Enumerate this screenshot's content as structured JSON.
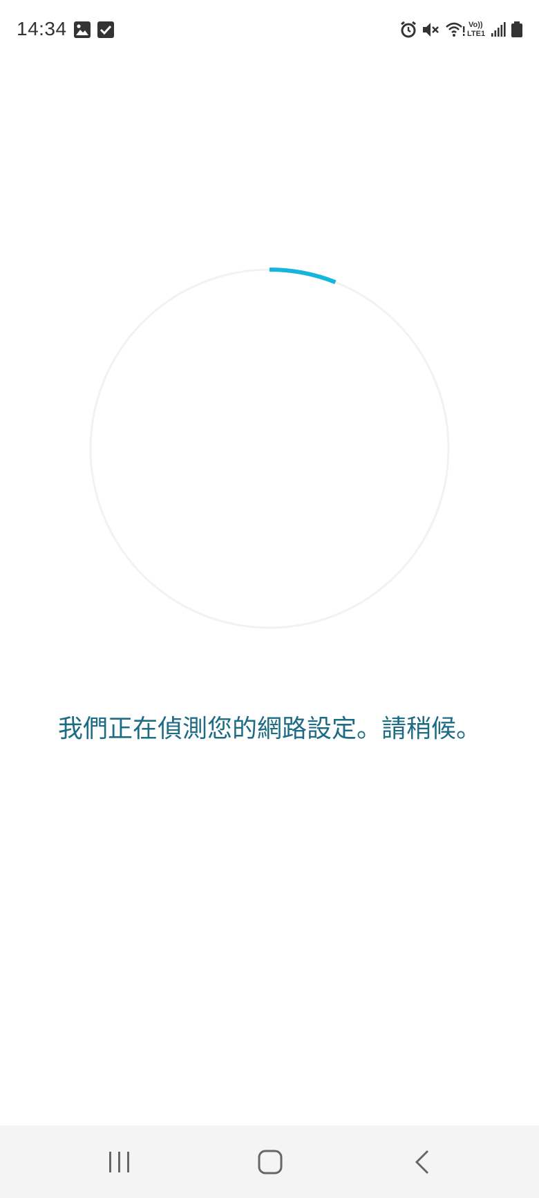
{
  "status_bar": {
    "time": "14:34",
    "left_icons": [
      "image-icon",
      "checkbox-icon"
    ],
    "right_icons": [
      "alarm-icon",
      "mute-icon",
      "wifi-icon",
      "volte-icon",
      "signal-icon",
      "battery-icon"
    ],
    "volte_label_top": "Vo))",
    "volte_label_bottom": "LTE1"
  },
  "loader": {
    "progress_fraction": 0.06,
    "track_color": "#f2f2f2",
    "progress_color": "#16b5dd"
  },
  "message": "我們正在偵測您的網路設定。請稍候。",
  "nav_bar": {
    "buttons": [
      "recent-apps",
      "home",
      "back"
    ]
  },
  "colors": {
    "text_accent": "#1d6c84",
    "nav_background": "#f4f4f4"
  }
}
